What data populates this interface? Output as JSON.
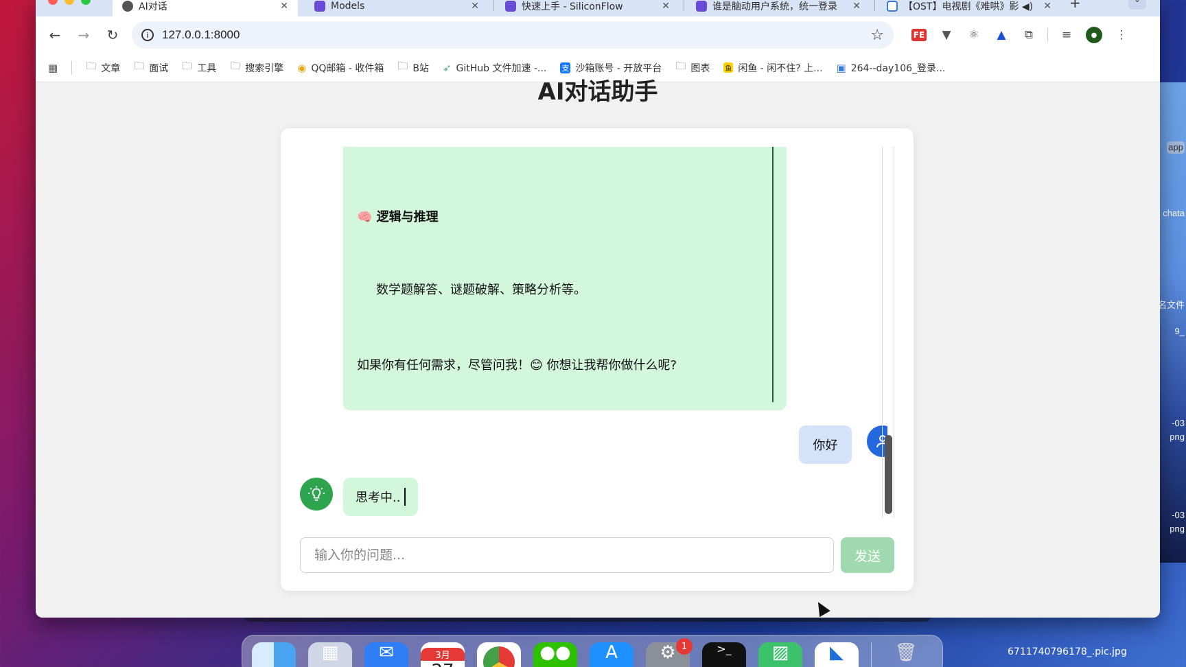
{
  "browser": {
    "tabs": [
      {
        "label": "AI对话",
        "active": true,
        "icon": "globe-icon"
      },
      {
        "label": "Models",
        "active": false,
        "icon": "ext-icon"
      },
      {
        "label": "快速上手 - SiliconFlow",
        "active": false,
        "icon": "ext-icon"
      },
      {
        "label": "谁是脑动用户系统，统一登录",
        "active": false,
        "icon": "ext-icon"
      },
      {
        "label": "【OST】电视剧《难哄》影 ◀)",
        "active": false,
        "icon": "calendar-icon"
      }
    ],
    "url": "127.0.0.1:8000",
    "bookmarks": [
      {
        "label": "文章",
        "icon": "folder-icon"
      },
      {
        "label": "面试",
        "icon": "folder-icon"
      },
      {
        "label": "工具",
        "icon": "folder-icon"
      },
      {
        "label": "搜索引擎",
        "icon": "folder-icon"
      },
      {
        "label": "QQ邮箱 - 收件箱",
        "icon": "qq-mail-icon"
      },
      {
        "label": "B站",
        "icon": "folder-icon"
      },
      {
        "label": "GitHub 文件加速 -...",
        "icon": "github-accel-icon"
      },
      {
        "label": "沙箱账号 - 开放平台",
        "icon": "alipay-icon"
      },
      {
        "label": "图表",
        "icon": "folder-icon"
      },
      {
        "label": "闲鱼 - 闲不住? 上...",
        "icon": "xianyu-icon"
      },
      {
        "label": "264--day106_登录...",
        "icon": "calendar-icon"
      }
    ]
  },
  "page": {
    "title": "AI对话助手",
    "messages": {
      "ai_heading": "🧠 逻辑与推理",
      "ai_paragraph": "数学题解答、谜题破解、策略分析等。",
      "ai_closing": "如果你有任何需求，尽管问我！😊 你想让我帮你做什么呢?",
      "user_message": "你好",
      "thinking": "思考中.."
    },
    "input_placeholder": "输入你的问题...",
    "send_label": "发送"
  },
  "desktop": {
    "side_labels": [
      "app",
      "chata",
      "名文件",
      "9_",
      "-03",
      "png",
      "-03",
      "png"
    ],
    "file_label": "6711740796178_.pic.jpg",
    "dock_badge": "1",
    "calendar_month": "3月",
    "calendar_day": "27"
  },
  "colors": {
    "ai_bubble": "#d3f7dc",
    "user_bubble": "#d5e3fa",
    "send_disabled": "#9fd9ad",
    "ai_avatar": "#2ea44f",
    "user_avatar": "#2468e0"
  }
}
